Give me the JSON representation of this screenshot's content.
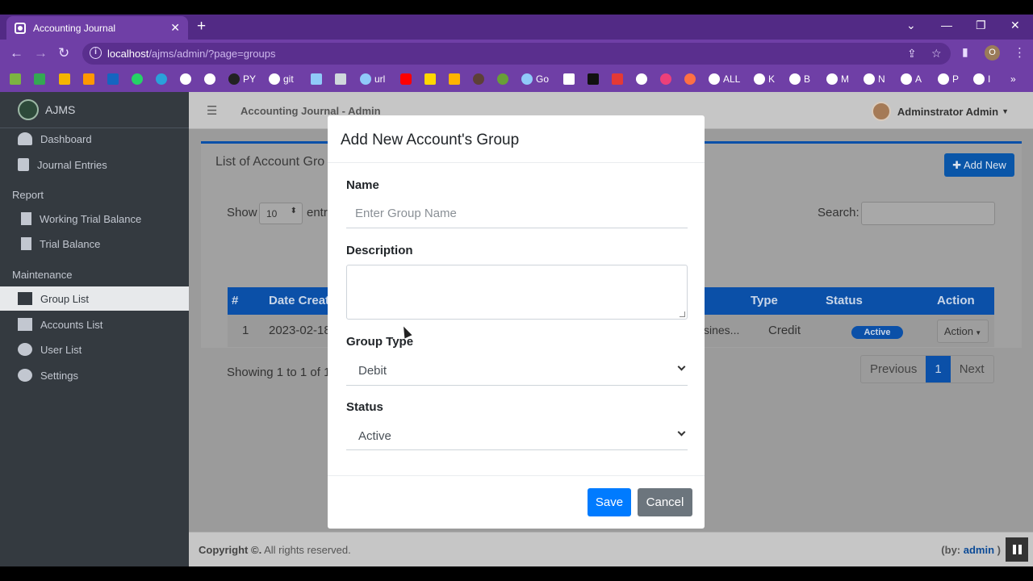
{
  "browser": {
    "tab_title": "Accounting Journal",
    "new_tab": "+",
    "url_host": "localhost",
    "url_path": "/ajms/admin/?page=groups",
    "profile_initial": "O",
    "bookmarks": [
      "PY",
      "git",
      "url",
      "Go",
      "ALL",
      "K",
      "B",
      "M",
      "N",
      "A",
      "P",
      "I"
    ]
  },
  "sidebar": {
    "brand": "AJMS",
    "items_top": [
      {
        "label": "Dashboard"
      },
      {
        "label": "Journal Entries"
      }
    ],
    "report_header": "Report",
    "report_items": [
      {
        "label": "Working Trial Balance"
      },
      {
        "label": "Trial Balance"
      }
    ],
    "maintenance_header": "Maintenance",
    "maintenance_items": [
      {
        "label": "Group List"
      },
      {
        "label": "Accounts List"
      },
      {
        "label": "User List"
      },
      {
        "label": "Settings"
      }
    ]
  },
  "topbar": {
    "title": "Accounting Journal - Admin",
    "user": "Adminstrator Admin"
  },
  "card": {
    "title": "List of Account Gro",
    "add_new": "Add New",
    "show": "Show",
    "entries_value": "10",
    "entries_suffix": "entr",
    "search_label": "Search:",
    "headers": [
      "#",
      "Date Creat",
      "Type",
      "Status",
      "Action"
    ],
    "row": {
      "num": "1",
      "date": "2023-02-18",
      "desc": "sines...",
      "type": "Credit",
      "status": "Active",
      "action": "Action"
    },
    "showing": "Showing 1 to 1 of 1",
    "pager": {
      "prev": "Previous",
      "page": "1",
      "next": "Next"
    }
  },
  "footer": {
    "copyright": "Copyright ©.",
    "rights": " All rights reserved.",
    "by_prefix": "(by: ",
    "by_name": "admin",
    "by_suffix": " )"
  },
  "modal": {
    "title": "Add New Account's Group",
    "name_label": "Name",
    "name_placeholder": "Enter Group Name",
    "description_label": "Description",
    "group_type_label": "Group Type",
    "group_type_value": "Debit",
    "status_label": "Status",
    "status_value": "Active",
    "save": "Save",
    "cancel": "Cancel"
  },
  "colors": {
    "primary": "#007bff",
    "accent": "#0b50a8",
    "sidebar": "#343a40",
    "browser": "#6f3fa6"
  }
}
